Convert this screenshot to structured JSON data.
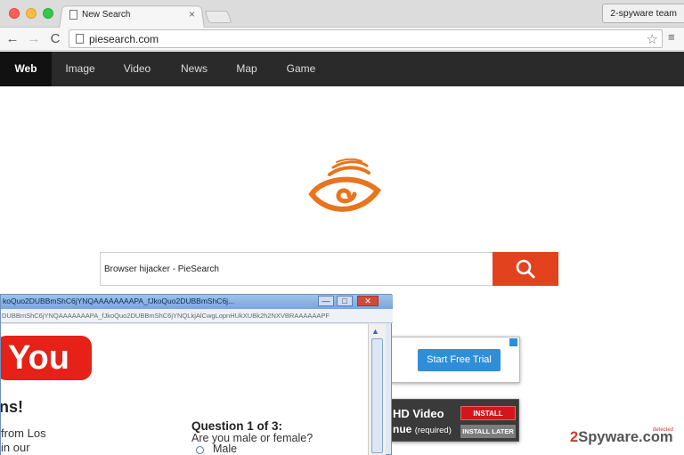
{
  "browser": {
    "tab_title": "New Search",
    "tab_close": "×",
    "profile_label": "2-spyware team",
    "url": "piesearch.com",
    "back_glyph": "←",
    "forward_glyph": "→",
    "reload_glyph": "C",
    "star_glyph": "☆",
    "menu_glyph": "≡"
  },
  "site_nav": {
    "items": [
      {
        "label": "Web",
        "active": true
      },
      {
        "label": "Image",
        "active": false
      },
      {
        "label": "Video",
        "active": false
      },
      {
        "label": "News",
        "active": false
      },
      {
        "label": "Map",
        "active": false
      },
      {
        "label": "Game",
        "active": false
      }
    ]
  },
  "logo": {
    "icon": "piesearch-eye-logo",
    "color": "#e8741c"
  },
  "search": {
    "value": "Browser hijacker - PieSearch",
    "button_icon": "search-icon",
    "button_color": "#e2421e"
  },
  "ads": {
    "trial_button": "Start Free Trial",
    "video_title": "HD Video",
    "video_sub": "nue",
    "video_required": "(required)",
    "install_label": "INSTALL",
    "install_later_label": "INSTALL LATER"
  },
  "popup": {
    "title": "koQuo2DUBBmShC6jYNQAAAAAAAAPA_fJkoQuo2DUBBmShC6j...",
    "minimize": "—",
    "maximize": "□",
    "close": "✕",
    "url": "DUBBmShC6jYNQAAAAAAAPA_fJkoQuo2DUBBmShC6jYNQLkjAlCwgLopnHUkXUBk2h2NXVBRAAAAAAPF",
    "logo_text": "You",
    "congrats": "ns!",
    "location_line1": "from Los",
    "location_line2": "in our",
    "question_title": "Question 1 of 3:",
    "question_text": "Are you male or female?",
    "option_male": "Male"
  },
  "watermark": {
    "digit": "2",
    "text": "Spyware.com",
    "sup": "detected"
  }
}
